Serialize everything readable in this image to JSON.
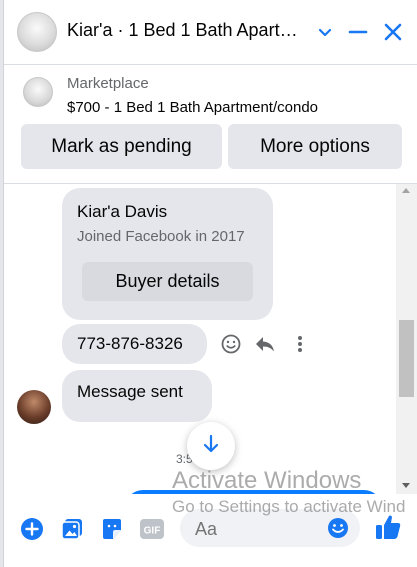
{
  "header": {
    "title": "Kiar'a · 1 Bed 1 Bath Apart…",
    "chevron_icon": "chevron-down-icon",
    "minimize_icon": "minimize-icon",
    "close_icon": "close-icon"
  },
  "marketplace": {
    "source": "Marketplace",
    "listing": "$700 - 1 Bed 1 Bath Apartment/condo",
    "mark_pending_label": "Mark as pending",
    "more_options_label": "More options"
  },
  "buyer_card": {
    "name": "Kiar'a Davis",
    "joined": "Joined Facebook in 2017",
    "button_label": "Buyer details"
  },
  "messages": [
    {
      "text": "773-876-8326"
    },
    {
      "text": "Message sent"
    }
  ],
  "timestamp": "3:5",
  "composer": {
    "placeholder": "Aa",
    "icons": [
      "plus-icon",
      "photo-icon",
      "sticker-icon",
      "gif-icon",
      "emoji-icon",
      "thumbs-up-icon"
    ],
    "gif_text": "GIF"
  },
  "watermark": {
    "line1": "Activate Windows",
    "line2": "Go to Settings to activate Wind"
  },
  "colors": {
    "accent": "#1877f2",
    "bubble": "#e4e6eb",
    "outgoing": "#0a7cff"
  }
}
